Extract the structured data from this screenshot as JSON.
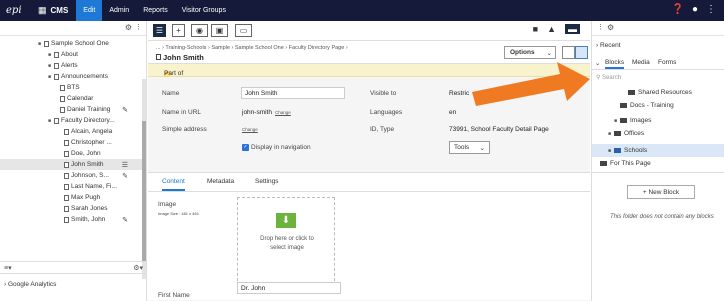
{
  "topbar": {
    "logo": "epi",
    "app": "CMS",
    "nav": [
      "Edit",
      "Admin",
      "Reports",
      "Visitor Groups"
    ],
    "help_icon": "help-icon",
    "user_icon": "user-icon",
    "menu_icon": "more-icon"
  },
  "tree": {
    "items": [
      {
        "label": "Sample School One",
        "indent": 0,
        "expander": "minus"
      },
      {
        "label": "About",
        "indent": 1,
        "expander": "plus"
      },
      {
        "label": "Alerts",
        "indent": 1,
        "expander": "plus"
      },
      {
        "label": "Announcements",
        "indent": 1,
        "expander": "plus"
      },
      {
        "label": "BTS",
        "indent": 2,
        "expander": ""
      },
      {
        "label": "Calendar",
        "indent": 2,
        "expander": ""
      },
      {
        "label": "Daniel Training",
        "indent": 2,
        "expander": ""
      },
      {
        "label": "Faculty Directory...",
        "indent": 1,
        "expander": "minus"
      },
      {
        "label": "Alcain, Angela",
        "indent": 2,
        "expander": ""
      },
      {
        "label": "Christopher ...",
        "indent": 2,
        "expander": ""
      },
      {
        "label": "Doe, John",
        "indent": 2,
        "expander": ""
      },
      {
        "label": "John Smith",
        "indent": 2,
        "expander": ""
      },
      {
        "label": "Johnson, S...",
        "indent": 2,
        "expander": ""
      },
      {
        "label": "Last Name, Fi...",
        "indent": 2,
        "expander": ""
      },
      {
        "label": "Max Pugh",
        "indent": 2,
        "expander": ""
      },
      {
        "label": "Sarah Jones",
        "indent": 2,
        "expander": ""
      },
      {
        "label": "Smith, John",
        "indent": 2,
        "expander": ""
      }
    ],
    "google_analytics": "Google Analytics"
  },
  "page": {
    "breadcrumb": "... › Training-Schools › Sample › Sample School One › Faculty Directory Page ›",
    "title": "John Smith",
    "options_label": "Options",
    "banner": "Part of current project",
    "name_label": "Name",
    "name_value": "John Smith",
    "url_label": "Name in URL",
    "url_value": "john-smith",
    "url_change": "Change",
    "simple_label": "Simple address",
    "simple_change": "Change",
    "display_nav": "Display in navigation",
    "visible_label": "Visible to",
    "visible_value": "Restric",
    "lang_label": "Languages",
    "lang_value": "en",
    "id_label": "ID, Type",
    "id_value": "73991, School Faculty Detail Page",
    "tools_label": "Tools",
    "tabs": [
      "Content",
      "Metadata",
      "Settings"
    ],
    "image_label": "Image",
    "image_size": "Image Size : 461 x 461",
    "drop_text_1": "Drop here or click to",
    "drop_text_2": "select image",
    "firstname_label": "First Name",
    "firstname_value": "Dr. John"
  },
  "right": {
    "recent": "Recent",
    "tabs": [
      "Blocks",
      "Media",
      "Forms"
    ],
    "search_placeholder": "Search",
    "folders": [
      "Shared Resources",
      "Docs - Training",
      "Images",
      "Offices",
      "Schools",
      "For This Page"
    ],
    "new_block": "+ New Block",
    "empty": "This folder does not contain any blocks"
  },
  "colors": {
    "topbar": "#151a3a",
    "accent": "#1e78d6",
    "banner": "#f8f3cc",
    "arrow": "#f07a22"
  }
}
